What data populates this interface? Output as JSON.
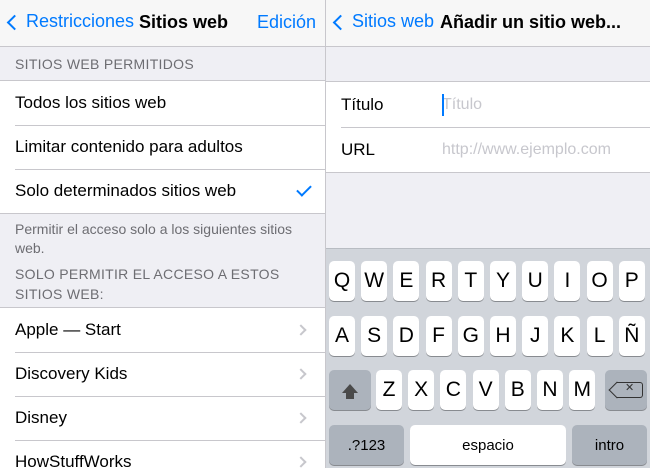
{
  "left": {
    "nav": {
      "back_label": "Restricciones",
      "title": "Sitios web",
      "edit_label": "Edición"
    },
    "allowed_header": "SITIOS WEB PERMITIDOS",
    "options": [
      {
        "label": "Todos los sitios web"
      },
      {
        "label": "Limitar contenido para adultos"
      },
      {
        "label": "Solo determinados sitios web",
        "checked": true
      }
    ],
    "options_footer": "Permitir el acceso solo a los siguientes sitios web.",
    "only_header": "SOLO PERMITIR EL ACCESO A ESTOS SITIOS WEB:",
    "sites": [
      {
        "label": "Apple — Start"
      },
      {
        "label": "Discovery Kids"
      },
      {
        "label": "Disney"
      },
      {
        "label": "HowStuffWorks"
      }
    ]
  },
  "right": {
    "nav": {
      "back_label": "Sitios web",
      "title": "Añadir un sitio web..."
    },
    "form": {
      "title_label": "Título",
      "title_placeholder": "Título",
      "url_label": "URL",
      "url_placeholder": "http://www.ejemplo.com"
    },
    "keyboard": {
      "row1": [
        "Q",
        "W",
        "E",
        "R",
        "T",
        "Y",
        "U",
        "I",
        "O",
        "P"
      ],
      "row2": [
        "A",
        "S",
        "D",
        "F",
        "G",
        "H",
        "J",
        "K",
        "L",
        "Ñ"
      ],
      "row3": [
        "Z",
        "X",
        "C",
        "V",
        "B",
        "N",
        "M"
      ],
      "numbers_key": ".?123",
      "space_key": "espacio",
      "return_key": "intro",
      "shift_icon": "shift-arrow-icon",
      "backspace_icon": "backspace-icon"
    }
  },
  "colors": {
    "accent": "#007aff",
    "background": "#efeff4",
    "separator": "#c8c7cc",
    "keyboard": "#d1d5db"
  }
}
